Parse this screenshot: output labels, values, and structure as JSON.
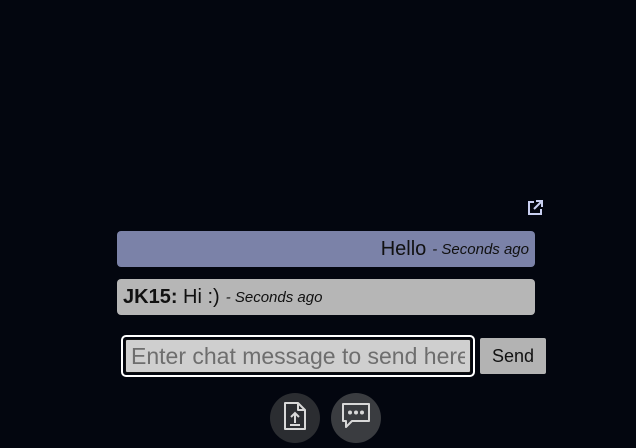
{
  "popout": {
    "icon": "external-link-icon",
    "color": "#c9cff0"
  },
  "messages": [
    {
      "author": "",
      "text": "Hello",
      "time": "- Seconds ago",
      "is_self": true,
      "bubble_color": "#7b82a8"
    },
    {
      "author": "JK15:",
      "text": " Hi :)",
      "time": "- Seconds ago",
      "is_self": false,
      "bubble_color": "#b6b6b6"
    }
  ],
  "composer": {
    "placeholder": "Enter chat message to send here",
    "value": "",
    "send_label": "Send"
  },
  "toolbar": {
    "upload_icon": "file-upload-icon",
    "chat_icon": "chat-bubble-icon"
  }
}
